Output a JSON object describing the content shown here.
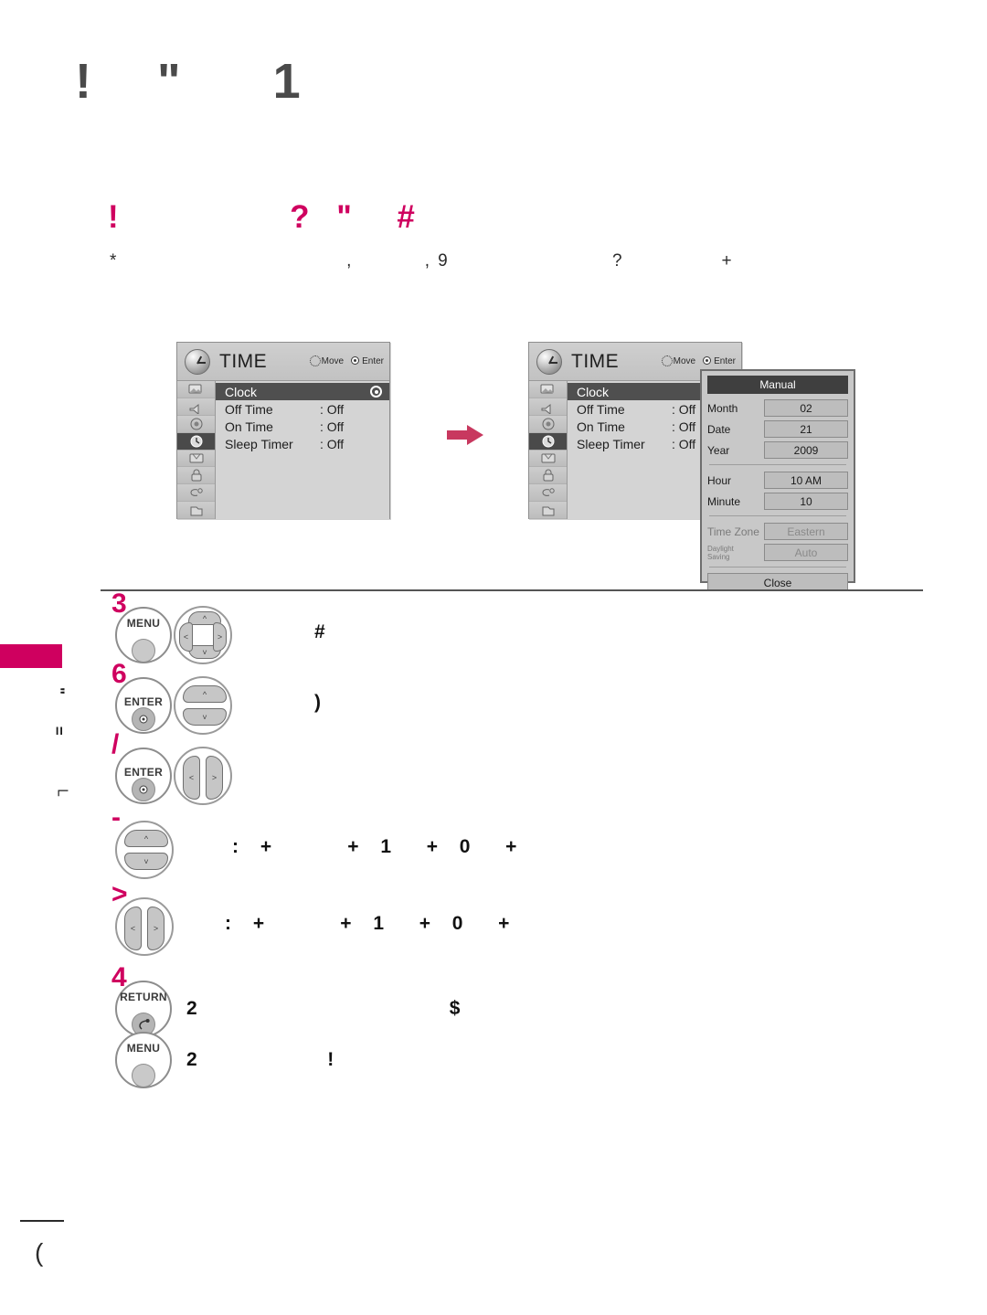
{
  "page": {
    "title": "!  \"   1",
    "section_title": "!         ? \"  #",
    "section_sub": "*                 ,     ,9            ?       +",
    "side_tab_label": "",
    "side_vertical_text": "\" =  └",
    "page_number": "("
  },
  "osd_left": {
    "title": "TIME",
    "hint_move": "Move",
    "hint_enter": "Enter",
    "icons": [
      "picture-icon",
      "audio-icon",
      "channel-icon",
      "time-icon",
      "option-icon",
      "lock-icon",
      "input-icon",
      "usb-icon"
    ],
    "selected_icon_index": 3,
    "rows": [
      {
        "label": "Clock",
        "value": "",
        "highlighted": true,
        "radio": true
      },
      {
        "label": "Off Time",
        "value": ": Off",
        "highlighted": false,
        "radio": false
      },
      {
        "label": "On Time",
        "value": ": Off",
        "highlighted": false,
        "radio": false
      },
      {
        "label": "Sleep Timer",
        "value": ": Off",
        "highlighted": false,
        "radio": false
      }
    ]
  },
  "osd_right": {
    "title": "TIME",
    "hint_move": "Move",
    "hint_enter": "Enter",
    "rows": [
      {
        "label": "Clock",
        "value": "",
        "highlighted": true,
        "radio": false
      },
      {
        "label": "Off Time",
        "value": ": Off",
        "highlighted": false,
        "radio": false
      },
      {
        "label": "On Time",
        "value": ": Off",
        "highlighted": false,
        "radio": false
      },
      {
        "label": "Sleep Timer",
        "value": ": Off",
        "highlighted": false,
        "radio": false
      }
    ]
  },
  "manual_dialog": {
    "title": "Manual",
    "fields": [
      {
        "label": "Month",
        "value": "02",
        "dim": false
      },
      {
        "label": "Date",
        "value": "21",
        "dim": false
      },
      {
        "label": "Year",
        "value": "2009",
        "dim": false
      },
      {
        "label": "Hour",
        "value": "10 AM",
        "dim": false
      },
      {
        "label": "Minute",
        "value": "10",
        "dim": false
      },
      {
        "label": "Time Zone",
        "value": "Eastern",
        "dim": true
      },
      {
        "label": "Daylight\nSaving",
        "value": "Auto",
        "dim": true
      }
    ],
    "close_label": "Close"
  },
  "steps": [
    {
      "num": "3",
      "buttons": [
        "MENU",
        "dpad-4way"
      ],
      "text": "#"
    },
    {
      "num": "6",
      "buttons": [
        "ENTER",
        "dpad-ud"
      ],
      "text": ")"
    },
    {
      "num": "/",
      "buttons": [
        "ENTER",
        "dpad-lr"
      ],
      "text": ""
    },
    {
      "num": "-",
      "buttons": [
        "dpad-ud"
      ],
      "text": ": +     + 1  + 0  +"
    },
    {
      "num": ">",
      "buttons": [
        "dpad-lr"
      ],
      "text": ": +     + 1  + 0  +"
    },
    {
      "num": "4",
      "buttons": [
        "RETURN"
      ],
      "text": "2                  $"
    },
    {
      "num": "",
      "buttons": [
        "MENU"
      ],
      "text": "2         !"
    }
  ],
  "labels": {
    "menu": "MENU",
    "enter": "ENTER",
    "return": "RETURN"
  },
  "colors": {
    "accent": "#cf005f",
    "arrow": "#c8385f",
    "osd_bg": "#d4d4d4",
    "osd_highlight": "#4f4f4f"
  }
}
